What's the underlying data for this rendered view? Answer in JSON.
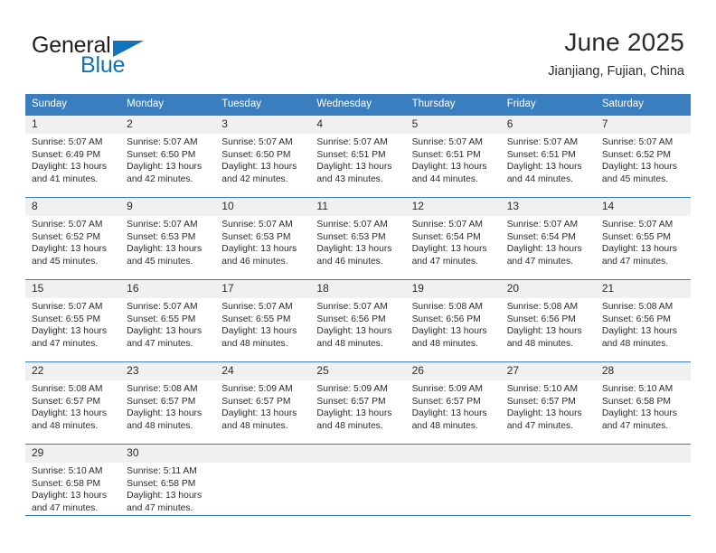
{
  "brand": {
    "line1": "General",
    "line2": "Blue",
    "triangle_icon": "brand-triangle-icon",
    "accent_color": "#1273bb"
  },
  "header": {
    "month_title": "June 2025",
    "location": "Jianjiang, Fujian, China"
  },
  "theme": {
    "header_blue": "#3b7ebf",
    "daynum_band": "#f0f0f0",
    "text": "#2b2b2b"
  },
  "calendar": {
    "weekday_headers": [
      "Sunday",
      "Monday",
      "Tuesday",
      "Wednesday",
      "Thursday",
      "Friday",
      "Saturday"
    ],
    "weeks": [
      [
        {
          "day": "1",
          "sunrise": "Sunrise: 5:07 AM",
          "sunset": "Sunset: 6:49 PM",
          "daylight1": "Daylight: 13 hours",
          "daylight2": "and 41 minutes."
        },
        {
          "day": "2",
          "sunrise": "Sunrise: 5:07 AM",
          "sunset": "Sunset: 6:50 PM",
          "daylight1": "Daylight: 13 hours",
          "daylight2": "and 42 minutes."
        },
        {
          "day": "3",
          "sunrise": "Sunrise: 5:07 AM",
          "sunset": "Sunset: 6:50 PM",
          "daylight1": "Daylight: 13 hours",
          "daylight2": "and 42 minutes."
        },
        {
          "day": "4",
          "sunrise": "Sunrise: 5:07 AM",
          "sunset": "Sunset: 6:51 PM",
          "daylight1": "Daylight: 13 hours",
          "daylight2": "and 43 minutes."
        },
        {
          "day": "5",
          "sunrise": "Sunrise: 5:07 AM",
          "sunset": "Sunset: 6:51 PM",
          "daylight1": "Daylight: 13 hours",
          "daylight2": "and 44 minutes."
        },
        {
          "day": "6",
          "sunrise": "Sunrise: 5:07 AM",
          "sunset": "Sunset: 6:51 PM",
          "daylight1": "Daylight: 13 hours",
          "daylight2": "and 44 minutes."
        },
        {
          "day": "7",
          "sunrise": "Sunrise: 5:07 AM",
          "sunset": "Sunset: 6:52 PM",
          "daylight1": "Daylight: 13 hours",
          "daylight2": "and 45 minutes."
        }
      ],
      [
        {
          "day": "8",
          "sunrise": "Sunrise: 5:07 AM",
          "sunset": "Sunset: 6:52 PM",
          "daylight1": "Daylight: 13 hours",
          "daylight2": "and 45 minutes."
        },
        {
          "day": "9",
          "sunrise": "Sunrise: 5:07 AM",
          "sunset": "Sunset: 6:53 PM",
          "daylight1": "Daylight: 13 hours",
          "daylight2": "and 45 minutes."
        },
        {
          "day": "10",
          "sunrise": "Sunrise: 5:07 AM",
          "sunset": "Sunset: 6:53 PM",
          "daylight1": "Daylight: 13 hours",
          "daylight2": "and 46 minutes."
        },
        {
          "day": "11",
          "sunrise": "Sunrise: 5:07 AM",
          "sunset": "Sunset: 6:53 PM",
          "daylight1": "Daylight: 13 hours",
          "daylight2": "and 46 minutes."
        },
        {
          "day": "12",
          "sunrise": "Sunrise: 5:07 AM",
          "sunset": "Sunset: 6:54 PM",
          "daylight1": "Daylight: 13 hours",
          "daylight2": "and 47 minutes."
        },
        {
          "day": "13",
          "sunrise": "Sunrise: 5:07 AM",
          "sunset": "Sunset: 6:54 PM",
          "daylight1": "Daylight: 13 hours",
          "daylight2": "and 47 minutes."
        },
        {
          "day": "14",
          "sunrise": "Sunrise: 5:07 AM",
          "sunset": "Sunset: 6:55 PM",
          "daylight1": "Daylight: 13 hours",
          "daylight2": "and 47 minutes."
        }
      ],
      [
        {
          "day": "15",
          "sunrise": "Sunrise: 5:07 AM",
          "sunset": "Sunset: 6:55 PM",
          "daylight1": "Daylight: 13 hours",
          "daylight2": "and 47 minutes."
        },
        {
          "day": "16",
          "sunrise": "Sunrise: 5:07 AM",
          "sunset": "Sunset: 6:55 PM",
          "daylight1": "Daylight: 13 hours",
          "daylight2": "and 47 minutes."
        },
        {
          "day": "17",
          "sunrise": "Sunrise: 5:07 AM",
          "sunset": "Sunset: 6:55 PM",
          "daylight1": "Daylight: 13 hours",
          "daylight2": "and 48 minutes."
        },
        {
          "day": "18",
          "sunrise": "Sunrise: 5:07 AM",
          "sunset": "Sunset: 6:56 PM",
          "daylight1": "Daylight: 13 hours",
          "daylight2": "and 48 minutes."
        },
        {
          "day": "19",
          "sunrise": "Sunrise: 5:08 AM",
          "sunset": "Sunset: 6:56 PM",
          "daylight1": "Daylight: 13 hours",
          "daylight2": "and 48 minutes."
        },
        {
          "day": "20",
          "sunrise": "Sunrise: 5:08 AM",
          "sunset": "Sunset: 6:56 PM",
          "daylight1": "Daylight: 13 hours",
          "daylight2": "and 48 minutes."
        },
        {
          "day": "21",
          "sunrise": "Sunrise: 5:08 AM",
          "sunset": "Sunset: 6:56 PM",
          "daylight1": "Daylight: 13 hours",
          "daylight2": "and 48 minutes."
        }
      ],
      [
        {
          "day": "22",
          "sunrise": "Sunrise: 5:08 AM",
          "sunset": "Sunset: 6:57 PM",
          "daylight1": "Daylight: 13 hours",
          "daylight2": "and 48 minutes."
        },
        {
          "day": "23",
          "sunrise": "Sunrise: 5:08 AM",
          "sunset": "Sunset: 6:57 PM",
          "daylight1": "Daylight: 13 hours",
          "daylight2": "and 48 minutes."
        },
        {
          "day": "24",
          "sunrise": "Sunrise: 5:09 AM",
          "sunset": "Sunset: 6:57 PM",
          "daylight1": "Daylight: 13 hours",
          "daylight2": "and 48 minutes."
        },
        {
          "day": "25",
          "sunrise": "Sunrise: 5:09 AM",
          "sunset": "Sunset: 6:57 PM",
          "daylight1": "Daylight: 13 hours",
          "daylight2": "and 48 minutes."
        },
        {
          "day": "26",
          "sunrise": "Sunrise: 5:09 AM",
          "sunset": "Sunset: 6:57 PM",
          "daylight1": "Daylight: 13 hours",
          "daylight2": "and 48 minutes."
        },
        {
          "day": "27",
          "sunrise": "Sunrise: 5:10 AM",
          "sunset": "Sunset: 6:57 PM",
          "daylight1": "Daylight: 13 hours",
          "daylight2": "and 47 minutes."
        },
        {
          "day": "28",
          "sunrise": "Sunrise: 5:10 AM",
          "sunset": "Sunset: 6:58 PM",
          "daylight1": "Daylight: 13 hours",
          "daylight2": "and 47 minutes."
        }
      ],
      [
        {
          "day": "29",
          "sunrise": "Sunrise: 5:10 AM",
          "sunset": "Sunset: 6:58 PM",
          "daylight1": "Daylight: 13 hours",
          "daylight2": "and 47 minutes."
        },
        {
          "day": "30",
          "sunrise": "Sunrise: 5:11 AM",
          "sunset": "Sunset: 6:58 PM",
          "daylight1": "Daylight: 13 hours",
          "daylight2": "and 47 minutes."
        },
        {
          "day": "",
          "sunrise": "",
          "sunset": "",
          "daylight1": "",
          "daylight2": ""
        },
        {
          "day": "",
          "sunrise": "",
          "sunset": "",
          "daylight1": "",
          "daylight2": ""
        },
        {
          "day": "",
          "sunrise": "",
          "sunset": "",
          "daylight1": "",
          "daylight2": ""
        },
        {
          "day": "",
          "sunrise": "",
          "sunset": "",
          "daylight1": "",
          "daylight2": ""
        },
        {
          "day": "",
          "sunrise": "",
          "sunset": "",
          "daylight1": "",
          "daylight2": ""
        }
      ]
    ]
  }
}
